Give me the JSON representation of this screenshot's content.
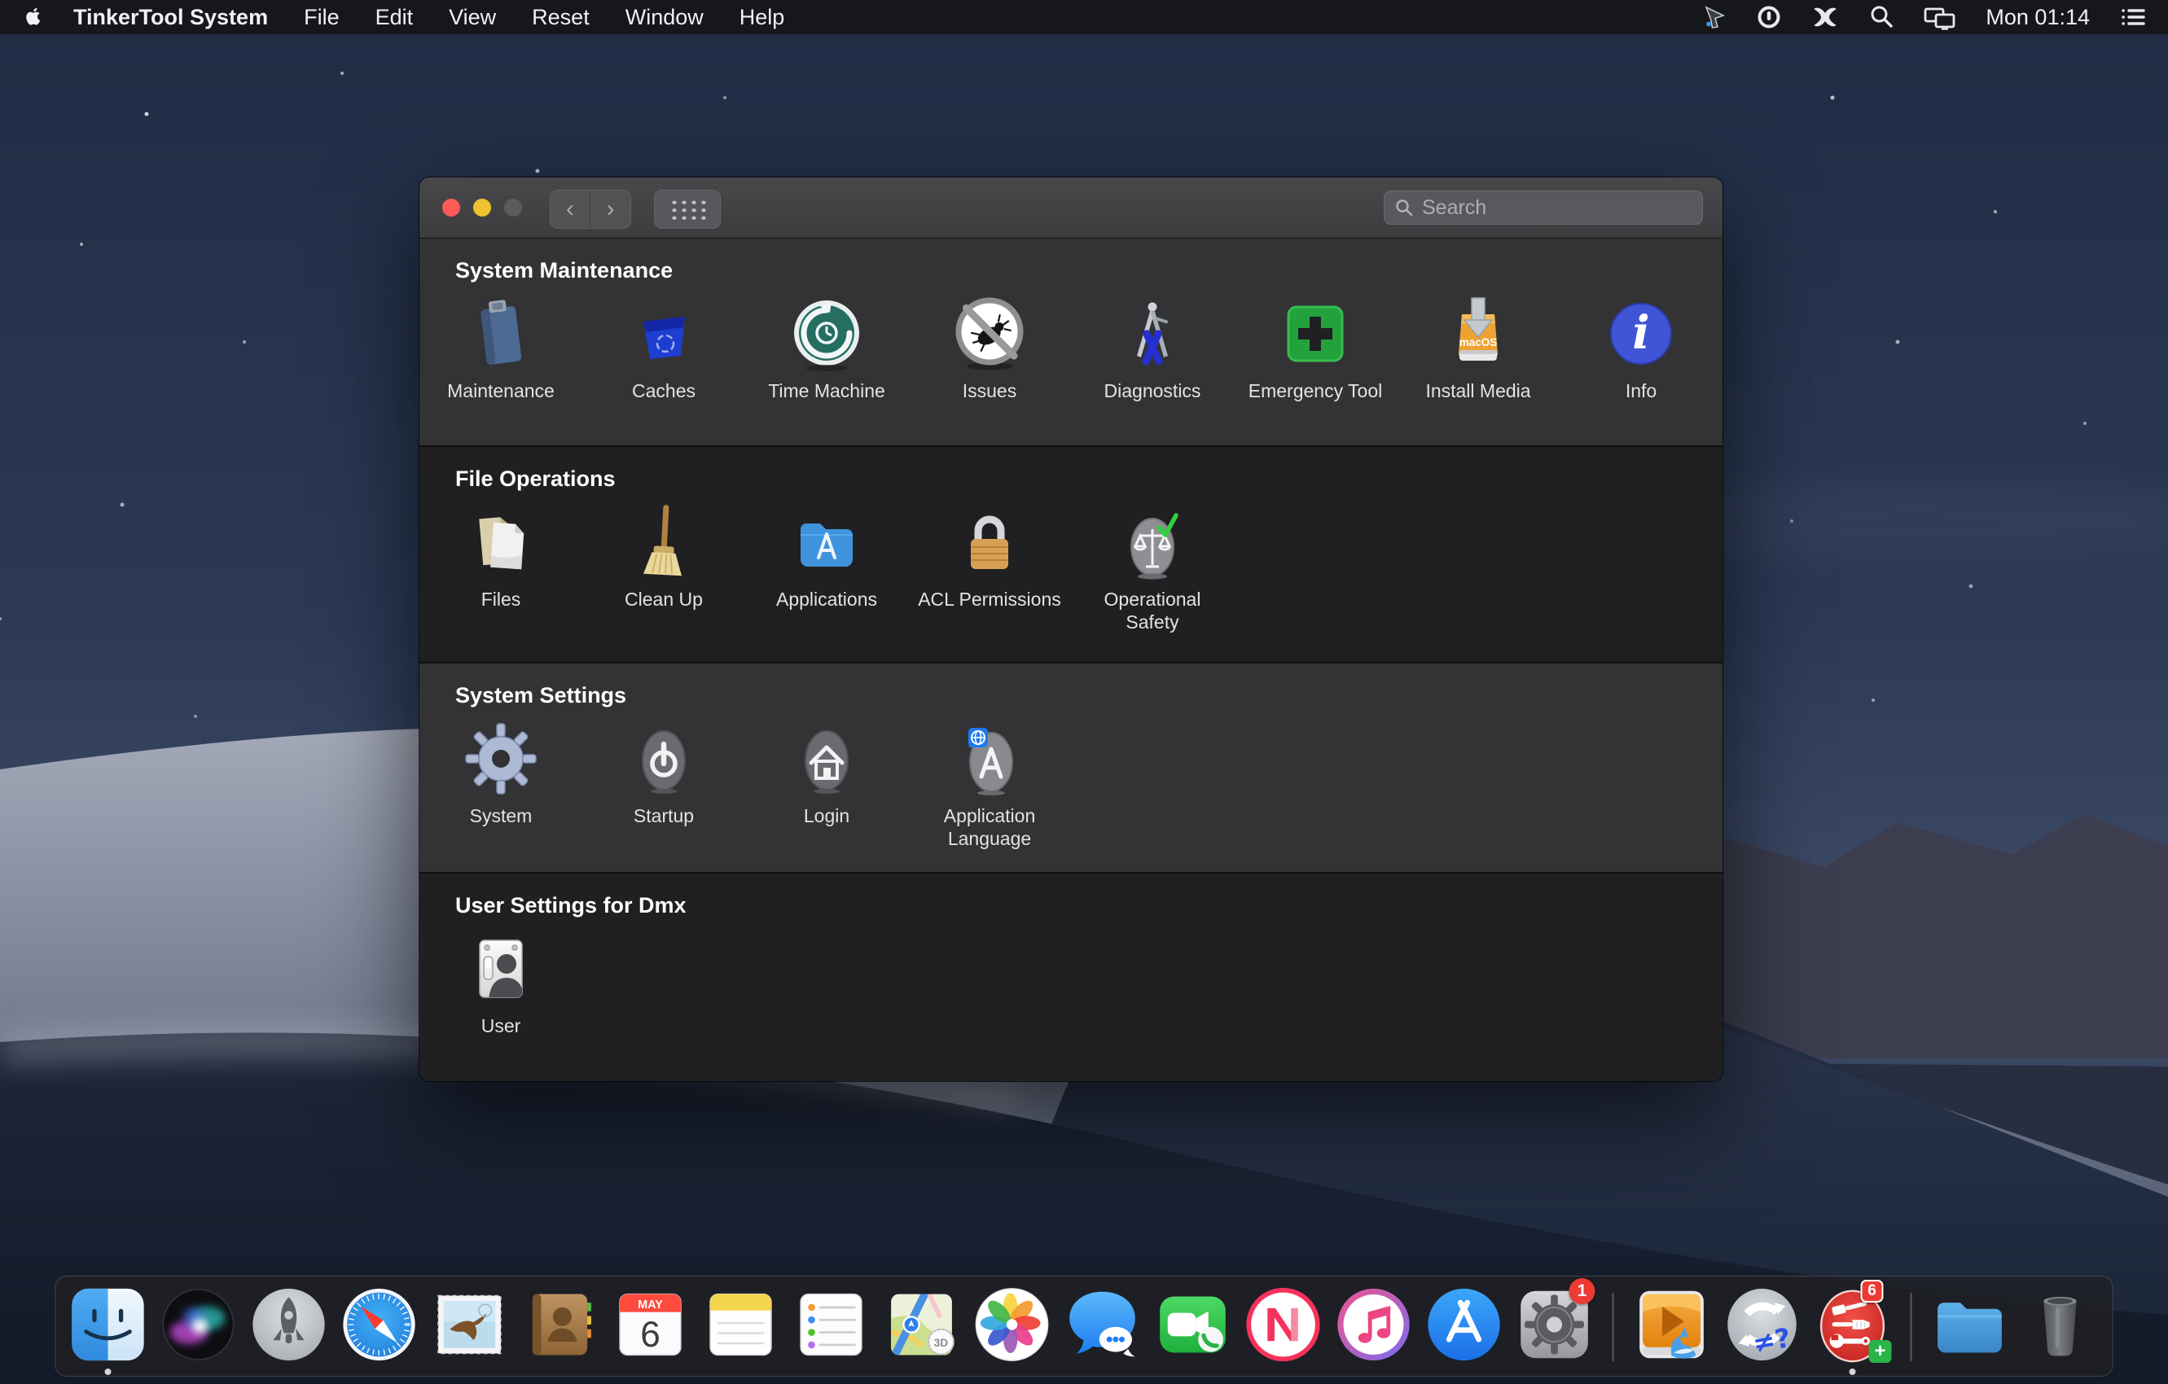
{
  "menubar": {
    "app_name": "TinkerTool System",
    "menus": [
      "File",
      "Edit",
      "View",
      "Reset",
      "Window",
      "Help"
    ],
    "clock": "Mon 01:14",
    "status_icons": [
      "pointer-tool-icon",
      "power-circle-icon",
      "antivirus-x-icon",
      "spotlight-search-icon",
      "screen-mirroring-icon",
      "notification-list-icon"
    ]
  },
  "window": {
    "toolbar": {
      "search_placeholder": "Search"
    },
    "sections": [
      {
        "title": "System Maintenance",
        "items": [
          {
            "label": "Maintenance",
            "icon": "maintenance"
          },
          {
            "label": "Caches",
            "icon": "caches"
          },
          {
            "label": "Time Machine",
            "icon": "time-machine"
          },
          {
            "label": "Issues",
            "icon": "issues"
          },
          {
            "label": "Diagnostics",
            "icon": "diagnostics"
          },
          {
            "label": "Emergency Tool",
            "icon": "emergency-tool"
          },
          {
            "label": "Install Media",
            "icon": "install-media"
          },
          {
            "label": "Info",
            "icon": "info"
          }
        ]
      },
      {
        "title": "File Operations",
        "items": [
          {
            "label": "Files",
            "icon": "files"
          },
          {
            "label": "Clean Up",
            "icon": "clean-up"
          },
          {
            "label": "Applications",
            "icon": "applications"
          },
          {
            "label": "ACL Permissions",
            "icon": "acl-permissions"
          },
          {
            "label": "Operational Safety",
            "icon": "operational-safety"
          }
        ]
      },
      {
        "title": "System Settings",
        "items": [
          {
            "label": "System",
            "icon": "system"
          },
          {
            "label": "Startup",
            "icon": "startup"
          },
          {
            "label": "Login",
            "icon": "login"
          },
          {
            "label": "Application Language",
            "icon": "application-language"
          }
        ]
      },
      {
        "title": "User Settings for Dmx",
        "items": [
          {
            "label": "User",
            "icon": "user"
          }
        ]
      }
    ]
  },
  "dock": {
    "items": [
      {
        "type": "app",
        "name": "finder",
        "running": true
      },
      {
        "type": "app",
        "name": "siri"
      },
      {
        "type": "app",
        "name": "launchpad"
      },
      {
        "type": "app",
        "name": "safari"
      },
      {
        "type": "app",
        "name": "mail"
      },
      {
        "type": "app",
        "name": "contacts"
      },
      {
        "type": "app",
        "name": "calendar"
      },
      {
        "type": "app",
        "name": "notes"
      },
      {
        "type": "app",
        "name": "reminders"
      },
      {
        "type": "app",
        "name": "maps"
      },
      {
        "type": "app",
        "name": "photos"
      },
      {
        "type": "app",
        "name": "messages"
      },
      {
        "type": "app",
        "name": "facetime"
      },
      {
        "type": "app",
        "name": "news"
      },
      {
        "type": "app",
        "name": "itunes"
      },
      {
        "type": "app",
        "name": "app-store"
      },
      {
        "type": "app",
        "name": "system-preferences",
        "badge": "1"
      },
      {
        "type": "divider"
      },
      {
        "type": "app",
        "name": "media-converter"
      },
      {
        "type": "app",
        "name": "sync-utility"
      },
      {
        "type": "app",
        "name": "tinkertool-system",
        "badge": "6",
        "plus_badge": "+",
        "running": true
      },
      {
        "type": "divider"
      },
      {
        "type": "app",
        "name": "downloads-folder"
      },
      {
        "type": "app",
        "name": "trash"
      }
    ]
  },
  "icon_texts": {
    "install_media": "macOS",
    "calendar_month": "MAY",
    "calendar_day": "6",
    "maps_3d": "3D",
    "sync_symbols": "≠?"
  },
  "colors": {
    "close_red": "#fc5b57",
    "minimize_yellow": "#eec32f",
    "zoom_disabled_gray": "#5b5b5b",
    "badge_red": "#ec3b33",
    "plus_green": "#28b446"
  }
}
